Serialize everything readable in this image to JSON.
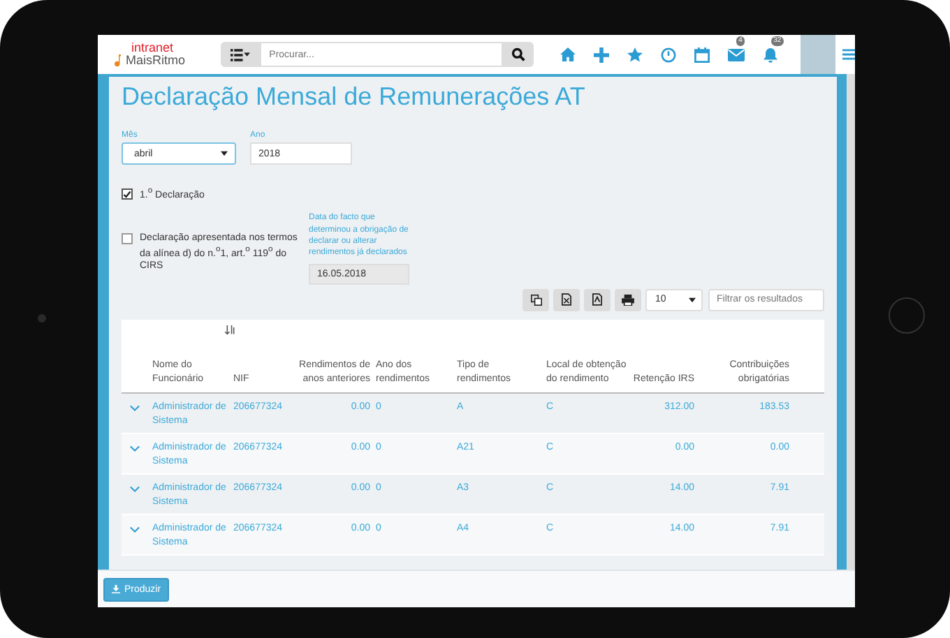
{
  "header": {
    "logo_top": "intranet",
    "logo_bottom": "MaisRitmo",
    "search": {
      "placeholder": "Procurar..."
    },
    "nav_icons": [
      {
        "kind": "home"
      },
      {
        "kind": "plus"
      },
      {
        "kind": "star"
      },
      {
        "kind": "clock"
      },
      {
        "kind": "calendar"
      },
      {
        "kind": "mail",
        "badge": "4"
      },
      {
        "kind": "bell",
        "badge": "32"
      }
    ]
  },
  "page": {
    "title": "Declaração Mensal de Remunerações AT",
    "month": {
      "label": "Mês",
      "value": "abril"
    },
    "year": {
      "label": "Ano",
      "value": "2018"
    },
    "checks": [
      {
        "label": "1.$^{o}$ Declaração",
        "checked": true
      },
      {
        "label": "Declaração apresentada nos termos da alínea d) do n.$^{o}$1, art.$^{o}$ 119$^{o}$ do CIRS",
        "checked": false
      }
    ],
    "fact_date": {
      "label": "Data do facto que determinou a obrigação de declarar ou alterar rendimentos já declarados",
      "value": "16.05.2018",
      "disabled": true
    },
    "toolbar": {
      "buttons": [
        {
          "kind": "copy"
        },
        {
          "kind": "excel"
        },
        {
          "kind": "pdf"
        },
        {
          "kind": "print"
        }
      ],
      "page_size": "10",
      "filter": {
        "placeholder": "Filtrar os resultados"
      }
    },
    "table": {
      "columns": [
        "Nome do Funcionário",
        "NIF",
        "Rendimentos de anos anteriores",
        "Ano dos rendimentos",
        "Tipo de rendimentos",
        "Local de obtenção do rendimento",
        "Retenção IRS",
        "Contribuições obrigatórias"
      ],
      "rows": [
        [
          "Administrador de Sistema",
          "206677324",
          "0.00",
          "0",
          "A",
          "C",
          "312.00",
          "183.53"
        ],
        [
          "Administrador de Sistema",
          "206677324",
          "0.00",
          "0",
          "A21",
          "C",
          "0.00",
          "0.00"
        ],
        [
          "Administrador de Sistema",
          "206677324",
          "0.00",
          "0",
          "A3",
          "C",
          "14.00",
          "7.91"
        ],
        [
          "Administrador de Sistema",
          "206677324",
          "0.00",
          "0",
          "A4",
          "C",
          "14.00",
          "7.91"
        ]
      ]
    },
    "footer_button": "Produzir"
  }
}
